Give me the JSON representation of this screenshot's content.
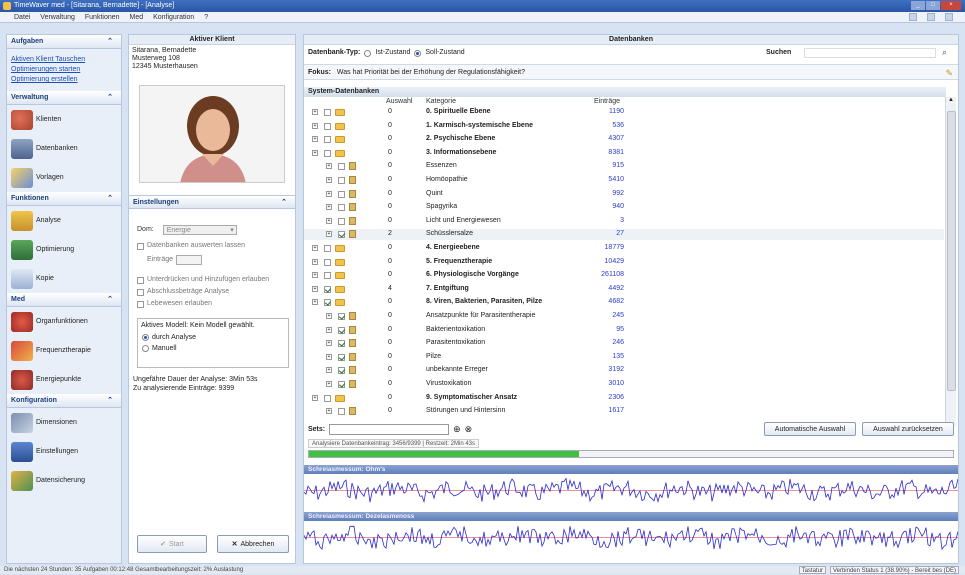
{
  "window": {
    "title": "TimeWaver med - [Sitarana, Bernadette] - [Analyse]"
  },
  "menu": [
    "Datei",
    "Verwaltung",
    "Funktionen",
    "Med",
    "Konfiguration",
    "?"
  ],
  "leftnav": {
    "aufgaben": {
      "title": "Aufgaben",
      "links": [
        "Aktiven Klient Tauschen",
        "Optimierungen starten",
        "Optimierung erstellen"
      ]
    },
    "verwaltung": {
      "title": "Verwaltung",
      "items": [
        "Klienten",
        "Datenbanken",
        "Vorlagen"
      ]
    },
    "funktionen": {
      "title": "Funktionen",
      "items": [
        "Analyse",
        "Optimierung",
        "Kopie"
      ]
    },
    "med": {
      "title": "Med",
      "items": [
        "Organfunktionen",
        "Frequenztherapie",
        "Energiepunkte"
      ]
    },
    "konfiguration": {
      "title": "Konfiguration",
      "items": [
        "Dimensionen",
        "Einstellungen",
        "Datensicherung"
      ]
    }
  },
  "client": {
    "header": "Aktiver Klient",
    "name": "Sitarana, Bernadette",
    "street": "Musterweg 108",
    "city": "12345 Musterhausen"
  },
  "settings": {
    "header": "Einstellungen",
    "dom_label": "Dom:",
    "dom_value": "Energie",
    "db_check": "Datenbanken auswerten lassen",
    "eintrag_label": "Einträge",
    "check2": "Unterdrücken und Hinzufügen erlauben",
    "check3": "Abschlussbeträge Analyse",
    "check4": "Lebewesen erlauben",
    "model_label": "Aktives Modell: Kein Modell gewählt.",
    "radio1": "durch Analyse",
    "radio2": "Manuell",
    "info1": "Ungefähre Dauer der Analyse: 3Min 53s",
    "info2": "Zu analysierende Einträge: 9399",
    "start_btn": "Start",
    "cancel_btn": "Abbrechen"
  },
  "databases": {
    "header": "Datenbanken",
    "type_label": "Datenbank-Typ:",
    "type_opt1": "Ist-Zustand",
    "type_opt2": "Soll-Zustand",
    "search_label": "Suchen",
    "fokus_label": "Fokus:",
    "fokus_value": "Was hat Priorität bei der Erhöhung der Regulationsfähigkeit?",
    "system_header": "System-Datenbanken",
    "col_auswahl": "Auswahl",
    "col_kategorie": "Kategorie",
    "col_eintraege": "Einträge",
    "rows": [
      {
        "cat": "0. Spirituelle Ebene",
        "sel": "0",
        "count": "1190",
        "bold": true,
        "lvl": 0,
        "checked": false
      },
      {
        "cat": "1. Karmisch-systemische Ebene",
        "sel": "0",
        "count": "536",
        "bold": true,
        "lvl": 0,
        "checked": false
      },
      {
        "cat": "2. Psychische Ebene",
        "sel": "0",
        "count": "4307",
        "bold": true,
        "lvl": 0,
        "checked": false
      },
      {
        "cat": "3. Informationsebene",
        "sel": "0",
        "count": "8381",
        "bold": true,
        "lvl": 0,
        "checked": false
      },
      {
        "cat": "Essenzen",
        "sel": "0",
        "count": "915",
        "bold": false,
        "lvl": 1,
        "checked": false
      },
      {
        "cat": "Homöopathie",
        "sel": "0",
        "count": "5410",
        "bold": false,
        "lvl": 1,
        "checked": false
      },
      {
        "cat": "Quint",
        "sel": "0",
        "count": "992",
        "bold": false,
        "lvl": 1,
        "checked": false
      },
      {
        "cat": "Spagyrika",
        "sel": "0",
        "count": "940",
        "bold": false,
        "lvl": 1,
        "checked": false
      },
      {
        "cat": "Licht und Energiewesen",
        "sel": "0",
        "count": "3",
        "bold": false,
        "lvl": 1,
        "checked": false
      },
      {
        "cat": "Schüsslersalze",
        "sel": "2",
        "count": "27",
        "bold": false,
        "lvl": 1,
        "checked": true
      },
      {
        "cat": "4. Energieebene",
        "sel": "0",
        "count": "18779",
        "bold": true,
        "lvl": 0,
        "checked": false
      },
      {
        "cat": "5. Frequenztherapie",
        "sel": "0",
        "count": "10429",
        "bold": true,
        "lvl": 0,
        "checked": false
      },
      {
        "cat": "6. Physiologische Vorgänge",
        "sel": "0",
        "count": "261108",
        "bold": true,
        "lvl": 0,
        "checked": false
      },
      {
        "cat": "7. Entgiftung",
        "sel": "4",
        "count": "4492",
        "bold": true,
        "lvl": 0,
        "checked": true
      },
      {
        "cat": "8. Viren, Bakterien, Parasiten, Pilze",
        "sel": "0",
        "count": "4682",
        "bold": true,
        "lvl": 0,
        "checked": true
      },
      {
        "cat": "Ansatzpunkte für Parasitentherapie",
        "sel": "0",
        "count": "245",
        "bold": false,
        "lvl": 1,
        "checked": true
      },
      {
        "cat": "Bakterientoxikation",
        "sel": "0",
        "count": "95",
        "bold": false,
        "lvl": 1,
        "checked": true
      },
      {
        "cat": "Parasitentoxikation",
        "sel": "0",
        "count": "246",
        "bold": false,
        "lvl": 1,
        "checked": true
      },
      {
        "cat": "Pilze",
        "sel": "0",
        "count": "135",
        "bold": false,
        "lvl": 1,
        "checked": true
      },
      {
        "cat": "unbekannte Erreger",
        "sel": "0",
        "count": "3192",
        "bold": false,
        "lvl": 1,
        "checked": true
      },
      {
        "cat": "Virustoxikation",
        "sel": "0",
        "count": "3010",
        "bold": false,
        "lvl": 1,
        "checked": true
      },
      {
        "cat": "9. Symptomatischer Ansatz",
        "sel": "0",
        "count": "2306",
        "bold": true,
        "lvl": 0,
        "checked": false
      },
      {
        "cat": "Störungen und Hintersinn",
        "sel": "0",
        "count": "1617",
        "bold": false,
        "lvl": 1,
        "checked": false
      }
    ],
    "sets_label": "Sets:",
    "auto_btn": "Automatische Auswahl",
    "reset_btn": "Auswahl zurücksetzen",
    "status_strip": "Analysiere Datenbankeintrag: 3456/9399 | Restzeit: 2Min 43s",
    "progress": 0.42
  },
  "waves": {
    "wave1_title": "Schreiasmessum: Ohm's",
    "wave2_title": "Schreiasmessum: Dezelasmenoss"
  },
  "statusbar": {
    "left": "Die nächsten 24 Stunden: 35 Aufgaben 00:12:48 Gesamtbearbeitungszeit: 2% Auslastung",
    "right1": "Tastatur",
    "right2": "Verbinden Status 1 (38.90%) - Bereit bes (DE)"
  },
  "colors": {
    "accent": "#2a56a6",
    "wave": "#2a2ad0",
    "progress": "#3fc23f",
    "count": "#2a3ec4"
  }
}
